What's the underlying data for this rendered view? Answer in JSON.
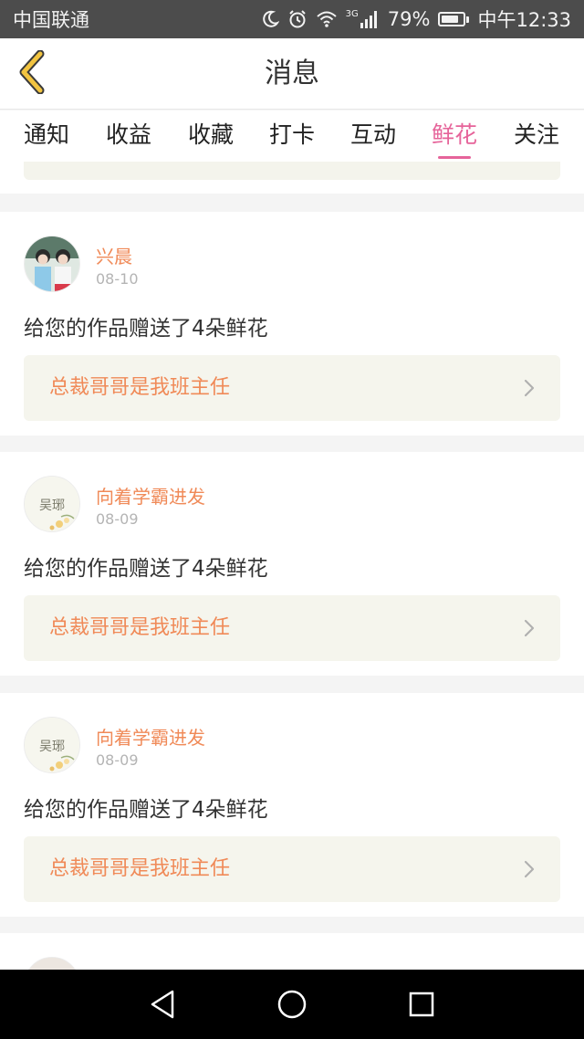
{
  "status_bar": {
    "carrier": "中国联通",
    "network": "3G",
    "battery_percent_text": "79%",
    "battery_level": 0.79,
    "time": "中午12:33",
    "icons": [
      "moon-icon",
      "alarm-icon",
      "wifi-icon",
      "signal-icon",
      "battery-icon"
    ]
  },
  "nav": {
    "title": "消息",
    "back_icon": "chevron-left-icon"
  },
  "tabs": [
    {
      "label": "通知",
      "active": false
    },
    {
      "label": "收益",
      "active": false
    },
    {
      "label": "收藏",
      "active": false
    },
    {
      "label": "打卡",
      "active": false
    },
    {
      "label": "互动",
      "active": false
    },
    {
      "label": "鲜花",
      "active": true
    },
    {
      "label": "关注",
      "active": false
    }
  ],
  "feed": [
    {
      "user": "兴晨",
      "date": "08-10",
      "message": "给您的作品赠送了4朵鲜花",
      "work_title": "总裁哥哥是我班主任",
      "avatar": "photo-avatar"
    },
    {
      "user": "向着学霸进发",
      "date": "08-09",
      "message": "给您的作品赠送了4朵鲜花",
      "work_title": "总裁哥哥是我班主任",
      "avatar": "flower-avatar"
    },
    {
      "user": "向着学霸进发",
      "date": "08-09",
      "message": "给您的作品赠送了4朵鲜花",
      "work_title": "总裁哥哥是我班主任",
      "avatar": "flower-avatar"
    }
  ],
  "colors": {
    "accent": "#e6649a",
    "name_orange": "#f08a58",
    "back_arrow": "#f2c440"
  },
  "system_nav": [
    "back-triangle-icon",
    "home-circle-icon",
    "recents-square-icon"
  ]
}
